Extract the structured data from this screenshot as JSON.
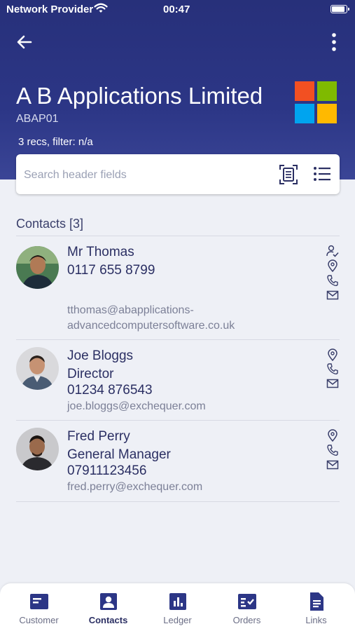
{
  "status_bar": {
    "carrier": "Network Provider",
    "time": "00:47"
  },
  "header": {
    "company_name": "A B Applications Limited",
    "company_code": "ABAP01",
    "records_text": "3 recs, filter: n/a"
  },
  "search": {
    "placeholder": "Search header fields",
    "value": ""
  },
  "contacts_section": {
    "title": "Contacts [3]",
    "contacts": [
      {
        "name": "Mr Thomas",
        "phone": "0117 655 8799",
        "email_line1": "tthomas@abapplications-",
        "email_line2": "advancedcomputersoftware.co.uk"
      },
      {
        "name": "Joe Bloggs",
        "role": "Director",
        "phone": "01234 876543",
        "email": "joe.bloggs@exchequer.com"
      },
      {
        "name": "Fred Perry",
        "role": "General Manager",
        "phone": "07911123456",
        "email": "fred.perry@exchequer.com"
      }
    ]
  },
  "tabs": [
    {
      "label": "Customer",
      "icon": "customer-card-icon"
    },
    {
      "label": "Contacts",
      "icon": "contact-badge-icon",
      "active": true
    },
    {
      "label": "Ledger",
      "icon": "bar-chart-icon"
    },
    {
      "label": "Orders",
      "icon": "checklist-icon"
    },
    {
      "label": "Links",
      "icon": "document-icon"
    }
  ],
  "colors": {
    "header": "#2c3686",
    "accent": "#2b2f63",
    "background": "#eef0f6"
  }
}
